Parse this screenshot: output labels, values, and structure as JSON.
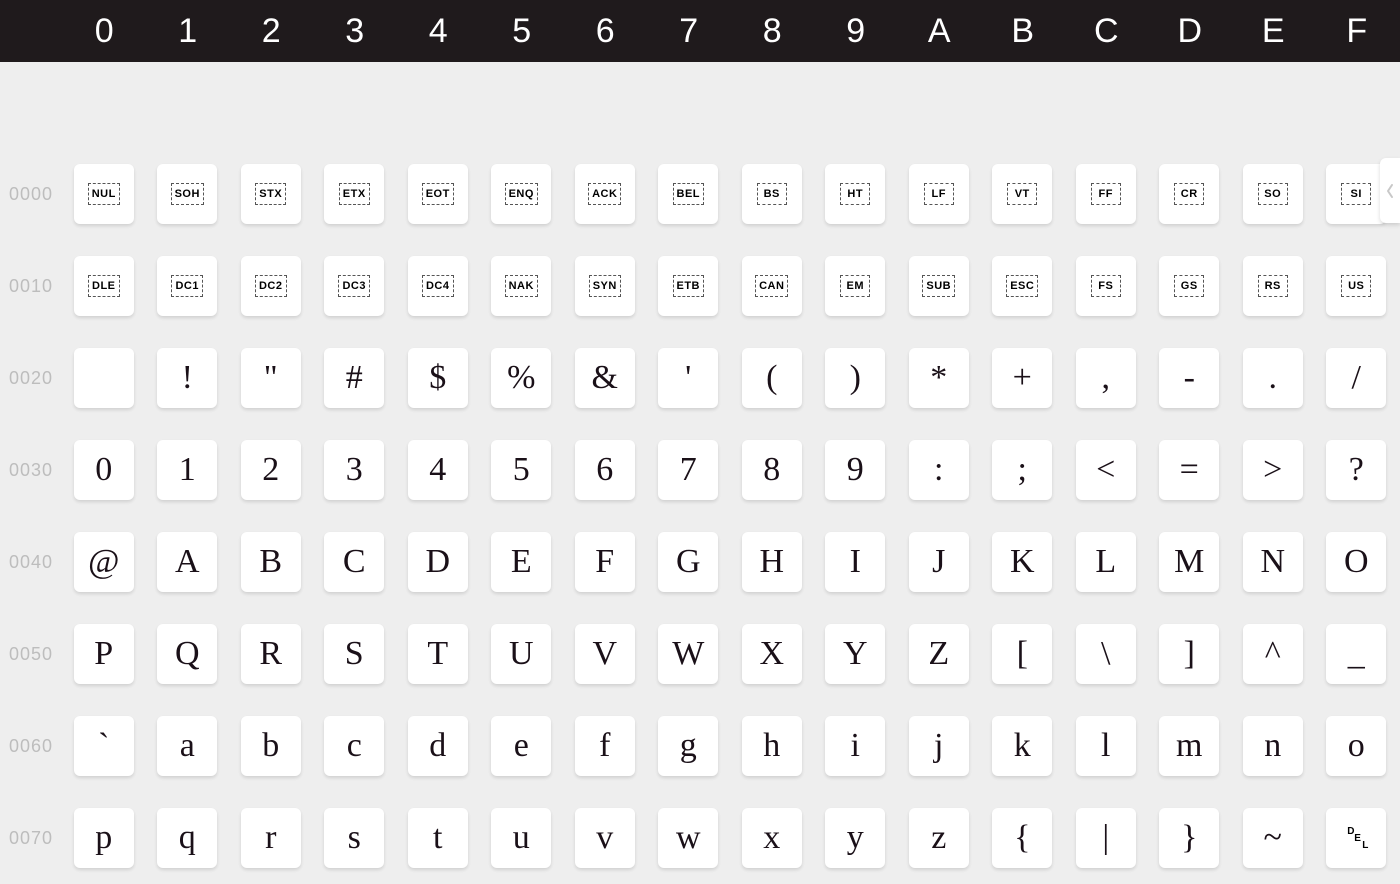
{
  "columns": [
    "0",
    "1",
    "2",
    "3",
    "4",
    "5",
    "6",
    "7",
    "8",
    "9",
    "A",
    "B",
    "C",
    "D",
    "E",
    "F"
  ],
  "rows": [
    {
      "label": "0000",
      "cells": [
        {
          "type": "ctrl",
          "text": "NUL"
        },
        {
          "type": "ctrl",
          "text": "SOH"
        },
        {
          "type": "ctrl",
          "text": "STX"
        },
        {
          "type": "ctrl",
          "text": "ETX"
        },
        {
          "type": "ctrl",
          "text": "EOT"
        },
        {
          "type": "ctrl",
          "text": "ENQ"
        },
        {
          "type": "ctrl",
          "text": "ACK"
        },
        {
          "type": "ctrl",
          "text": "BEL"
        },
        {
          "type": "ctrl",
          "text": "BS"
        },
        {
          "type": "ctrl",
          "text": "HT"
        },
        {
          "type": "ctrl",
          "text": "LF"
        },
        {
          "type": "ctrl",
          "text": "VT"
        },
        {
          "type": "ctrl",
          "text": "FF"
        },
        {
          "type": "ctrl",
          "text": "CR"
        },
        {
          "type": "ctrl",
          "text": "SO"
        },
        {
          "type": "ctrl",
          "text": "SI"
        }
      ]
    },
    {
      "label": "0010",
      "cells": [
        {
          "type": "ctrl",
          "text": "DLE"
        },
        {
          "type": "ctrl",
          "text": "DC1"
        },
        {
          "type": "ctrl",
          "text": "DC2"
        },
        {
          "type": "ctrl",
          "text": "DC3"
        },
        {
          "type": "ctrl",
          "text": "DC4"
        },
        {
          "type": "ctrl",
          "text": "NAK"
        },
        {
          "type": "ctrl",
          "text": "SYN"
        },
        {
          "type": "ctrl",
          "text": "ETB"
        },
        {
          "type": "ctrl",
          "text": "CAN"
        },
        {
          "type": "ctrl",
          "text": "EM"
        },
        {
          "type": "ctrl",
          "text": "SUB"
        },
        {
          "type": "ctrl",
          "text": "ESC"
        },
        {
          "type": "ctrl",
          "text": "FS"
        },
        {
          "type": "ctrl",
          "text": "GS"
        },
        {
          "type": "ctrl",
          "text": "RS"
        },
        {
          "type": "ctrl",
          "text": "US"
        }
      ]
    },
    {
      "label": "0020",
      "cells": [
        {
          "type": "glyph",
          "text": " "
        },
        {
          "type": "glyph",
          "text": "!"
        },
        {
          "type": "glyph",
          "text": "\""
        },
        {
          "type": "glyph",
          "text": "#"
        },
        {
          "type": "glyph",
          "text": "$"
        },
        {
          "type": "glyph",
          "text": "%"
        },
        {
          "type": "glyph",
          "text": "&"
        },
        {
          "type": "glyph",
          "text": "'"
        },
        {
          "type": "glyph",
          "text": "("
        },
        {
          "type": "glyph",
          "text": ")"
        },
        {
          "type": "glyph",
          "text": "*"
        },
        {
          "type": "glyph",
          "text": "+"
        },
        {
          "type": "glyph",
          "text": ","
        },
        {
          "type": "glyph",
          "text": "-"
        },
        {
          "type": "glyph",
          "text": "."
        },
        {
          "type": "glyph",
          "text": "/"
        }
      ]
    },
    {
      "label": "0030",
      "cells": [
        {
          "type": "glyph",
          "text": "0"
        },
        {
          "type": "glyph",
          "text": "1"
        },
        {
          "type": "glyph",
          "text": "2"
        },
        {
          "type": "glyph",
          "text": "3"
        },
        {
          "type": "glyph",
          "text": "4"
        },
        {
          "type": "glyph",
          "text": "5"
        },
        {
          "type": "glyph",
          "text": "6"
        },
        {
          "type": "glyph",
          "text": "7"
        },
        {
          "type": "glyph",
          "text": "8"
        },
        {
          "type": "glyph",
          "text": "9"
        },
        {
          "type": "glyph",
          "text": ":"
        },
        {
          "type": "glyph",
          "text": ";"
        },
        {
          "type": "glyph",
          "text": "<"
        },
        {
          "type": "glyph",
          "text": "="
        },
        {
          "type": "glyph",
          "text": ">"
        },
        {
          "type": "glyph",
          "text": "?"
        }
      ]
    },
    {
      "label": "0040",
      "cells": [
        {
          "type": "glyph",
          "text": "@"
        },
        {
          "type": "glyph",
          "text": "A"
        },
        {
          "type": "glyph",
          "text": "B"
        },
        {
          "type": "glyph",
          "text": "C"
        },
        {
          "type": "glyph",
          "text": "D"
        },
        {
          "type": "glyph",
          "text": "E"
        },
        {
          "type": "glyph",
          "text": "F"
        },
        {
          "type": "glyph",
          "text": "G"
        },
        {
          "type": "glyph",
          "text": "H"
        },
        {
          "type": "glyph",
          "text": "I"
        },
        {
          "type": "glyph",
          "text": "J"
        },
        {
          "type": "glyph",
          "text": "K"
        },
        {
          "type": "glyph",
          "text": "L"
        },
        {
          "type": "glyph",
          "text": "M"
        },
        {
          "type": "glyph",
          "text": "N"
        },
        {
          "type": "glyph",
          "text": "O"
        }
      ]
    },
    {
      "label": "0050",
      "cells": [
        {
          "type": "glyph",
          "text": "P"
        },
        {
          "type": "glyph",
          "text": "Q"
        },
        {
          "type": "glyph",
          "text": "R"
        },
        {
          "type": "glyph",
          "text": "S"
        },
        {
          "type": "glyph",
          "text": "T"
        },
        {
          "type": "glyph",
          "text": "U"
        },
        {
          "type": "glyph",
          "text": "V"
        },
        {
          "type": "glyph",
          "text": "W"
        },
        {
          "type": "glyph",
          "text": "X"
        },
        {
          "type": "glyph",
          "text": "Y"
        },
        {
          "type": "glyph",
          "text": "Z"
        },
        {
          "type": "glyph",
          "text": "["
        },
        {
          "type": "glyph",
          "text": "\\"
        },
        {
          "type": "glyph",
          "text": "]"
        },
        {
          "type": "glyph",
          "text": "^"
        },
        {
          "type": "glyph",
          "text": "_"
        }
      ]
    },
    {
      "label": "0060",
      "cells": [
        {
          "type": "glyph",
          "text": "`"
        },
        {
          "type": "glyph",
          "text": "a"
        },
        {
          "type": "glyph",
          "text": "b"
        },
        {
          "type": "glyph",
          "text": "c"
        },
        {
          "type": "glyph",
          "text": "d"
        },
        {
          "type": "glyph",
          "text": "e"
        },
        {
          "type": "glyph",
          "text": "f"
        },
        {
          "type": "glyph",
          "text": "g"
        },
        {
          "type": "glyph",
          "text": "h"
        },
        {
          "type": "glyph",
          "text": "i"
        },
        {
          "type": "glyph",
          "text": "j"
        },
        {
          "type": "glyph",
          "text": "k"
        },
        {
          "type": "glyph",
          "text": "l"
        },
        {
          "type": "glyph",
          "text": "m"
        },
        {
          "type": "glyph",
          "text": "n"
        },
        {
          "type": "glyph",
          "text": "o"
        }
      ]
    },
    {
      "label": "0070",
      "cells": [
        {
          "type": "glyph",
          "text": "p"
        },
        {
          "type": "glyph",
          "text": "q"
        },
        {
          "type": "glyph",
          "text": "r"
        },
        {
          "type": "glyph",
          "text": "s"
        },
        {
          "type": "glyph",
          "text": "t"
        },
        {
          "type": "glyph",
          "text": "u"
        },
        {
          "type": "glyph",
          "text": "v"
        },
        {
          "type": "glyph",
          "text": "w"
        },
        {
          "type": "glyph",
          "text": "x"
        },
        {
          "type": "glyph",
          "text": "y"
        },
        {
          "type": "glyph",
          "text": "z"
        },
        {
          "type": "glyph",
          "text": "{"
        },
        {
          "type": "glyph",
          "text": "|"
        },
        {
          "type": "glyph",
          "text": "}"
        },
        {
          "type": "glyph",
          "text": "~"
        },
        {
          "type": "del",
          "text": "DEL"
        }
      ]
    }
  ],
  "arrow_icon": "chevron-left"
}
